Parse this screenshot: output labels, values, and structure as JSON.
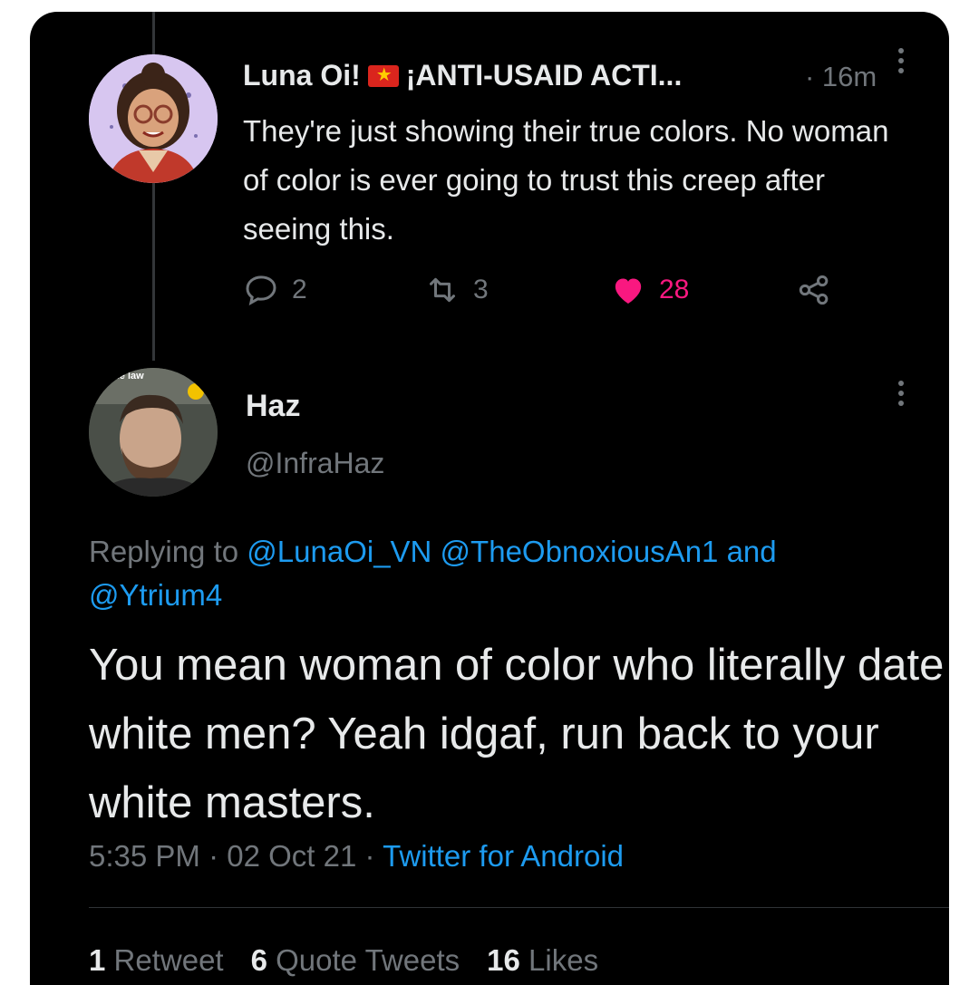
{
  "reply_parent": {
    "display_name": "Luna Oi!",
    "name_suffix": "¡ANTI-USAID ACTI...",
    "time": "· 16m",
    "text": "They're just showing their true colors. No woman of color is ever going to trust this creep after seeing this.",
    "replies": "2",
    "retweets": "3",
    "likes": "28"
  },
  "tweet": {
    "display_name": "Haz",
    "handle": "@InfraHaz",
    "avatar_text": "ack the law",
    "replying_label": "Replying to",
    "replying_to": "@LunaOi_VN @TheObnoxiousAn1 and @Ytrium4",
    "text": "You mean woman of color who literally date white men? Yeah idgaf, run back to your white masters.",
    "time": "5:35 PM",
    "date": "02 Oct 21",
    "source": "Twitter for Android",
    "stats": {
      "retweets_count": "1",
      "retweets_label": "Retweet",
      "quotes_count": "6",
      "quotes_label": "Quote Tweets",
      "likes_count": "16",
      "likes_label": "Likes"
    }
  },
  "colors": {
    "background": "#000000",
    "text": "#e7e9ea",
    "muted": "#71767b",
    "link": "#1d9bf0",
    "like": "#f91880"
  }
}
